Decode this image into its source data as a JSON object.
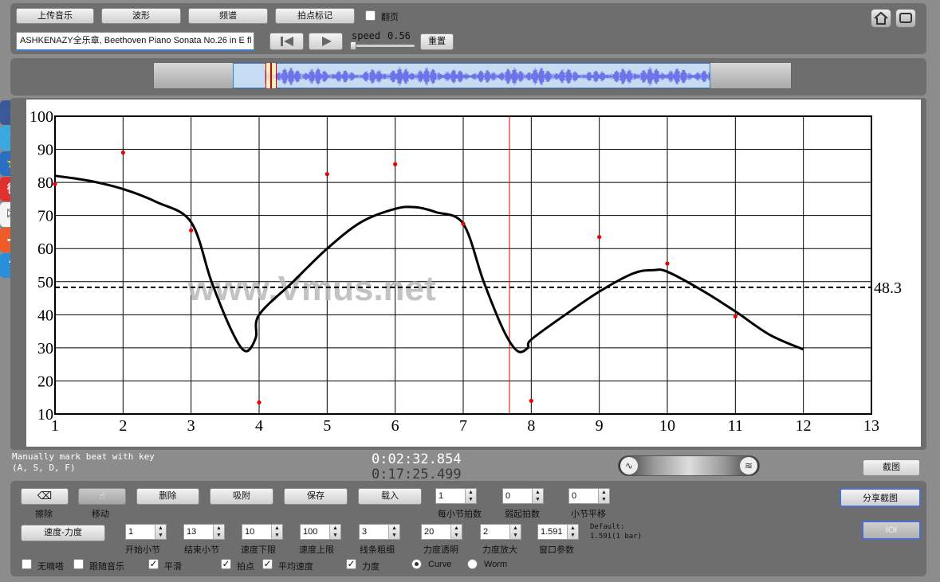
{
  "toolbar": {
    "upload": "上传音乐",
    "waveform": "波形",
    "spectrum": "频谱",
    "beat_mark": "拍点标记",
    "flip": "翻页",
    "title_input": "ASHKENAZY全乐章, Beethoven Piano Sonata No.26 in E fl",
    "speed_label": "speed",
    "speed_value": "0.56",
    "reset": "重置"
  },
  "chart_data": {
    "type": "line",
    "xlim": [
      1,
      13
    ],
    "ylim": [
      10,
      100
    ],
    "x_ticks": [
      "1",
      "2",
      "3",
      "4",
      "5",
      "6",
      "7",
      "8",
      "9",
      "10",
      "11",
      "12",
      "13"
    ],
    "y_ticks": [
      "10",
      "20",
      "30",
      "40",
      "50",
      "60",
      "70",
      "80",
      "90",
      "100"
    ],
    "series": [
      {
        "values": [
          [
            1,
            82
          ],
          [
            1.5,
            80.5
          ],
          [
            2,
            78
          ],
          [
            2.5,
            74
          ],
          [
            3,
            68
          ],
          [
            3.3,
            50
          ],
          [
            3.6,
            35
          ],
          [
            3.8,
            29
          ],
          [
            3.95,
            33
          ],
          [
            4,
            40
          ],
          [
            4.5,
            50
          ],
          [
            5,
            60
          ],
          [
            5.5,
            68
          ],
          [
            6,
            72
          ],
          [
            6.3,
            72.5
          ],
          [
            6.6,
            71
          ],
          [
            7,
            67.5
          ],
          [
            7.3,
            50
          ],
          [
            7.6,
            35
          ],
          [
            7.8,
            29
          ],
          [
            7.95,
            30
          ],
          [
            8,
            32.5
          ],
          [
            8.5,
            40
          ],
          [
            9,
            47
          ],
          [
            9.5,
            52.5
          ],
          [
            9.8,
            53.5
          ],
          [
            10,
            53
          ],
          [
            10.5,
            47.5
          ],
          [
            11,
            41
          ],
          [
            11.5,
            34
          ],
          [
            12,
            29.5
          ]
        ]
      }
    ],
    "points": [
      [
        1,
        79.5
      ],
      [
        2,
        89
      ],
      [
        3,
        65.5
      ],
      [
        4,
        13.5
      ],
      [
        5,
        82.5
      ],
      [
        6,
        85.5
      ],
      [
        7,
        67.5
      ],
      [
        8,
        14
      ],
      [
        9,
        63.5
      ],
      [
        10,
        55.5
      ],
      [
        11,
        39.5
      ]
    ],
    "average": 48.3,
    "average_label": "48.3",
    "cursor_x": 7.68,
    "watermark": "www.Vmus.net",
    "grid": true
  },
  "status": {
    "hint_line1": "Manually mark beat with key",
    "hint_line2": "(A, S, D, F)",
    "time_current": "0:02:32.854",
    "time_total": "0:17:25.499",
    "screenshot": "截图"
  },
  "controls": {
    "erase": "擦除",
    "move": "移动",
    "delete": "删除",
    "snap": "吸附",
    "save": "保存",
    "load": "载入",
    "beats_per_bar_value": "1",
    "beats_per_bar": "每小节拍数",
    "pickup_value": "0",
    "pickup": "弱起拍数",
    "bar_shift_value": "0",
    "bar_shift": "小节平移",
    "share": "分享截图",
    "ioi": "IOI",
    "tempo_dynamics": "速度-力度",
    "start_bar_value": "1",
    "start_bar": "开始小节",
    "end_bar_value": "13",
    "end_bar": "结束小节",
    "tempo_min_value": "10",
    "tempo_min": "速度下限",
    "tempo_max_value": "100",
    "tempo_max": "速度上限",
    "line_width_value": "3",
    "line_width": "线条粗细",
    "dyn_alpha_value": "20",
    "dyn_alpha": "力度透明",
    "dyn_zoom_value": "2",
    "dyn_zoom": "力度放大",
    "window_value": "1.591",
    "window": "窗口参数",
    "default_line1": "Default:",
    "default_line2": "1.591(1 bar)",
    "no_ticking": "无嘀嗒",
    "follow_music": "跟随音乐",
    "smooth": "平滑",
    "beat_points": "拍点",
    "avg_tempo": "平均速度",
    "dynamics": "力度",
    "curve": "Curve",
    "worm": "Worm"
  }
}
